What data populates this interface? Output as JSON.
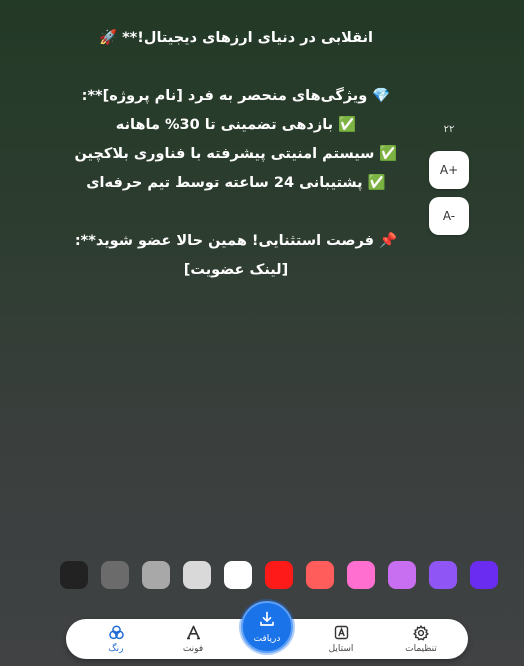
{
  "post": {
    "lines": [
      "انقلابی در دنیای ارزهای دیجیتال!** 🚀",
      "",
      "💎 ویژگی‌های منحصر به فرد [نام پروژه]**:",
      "✅ بازدهی تضمینی تا 30% ماهانه",
      "✅ سیستم امنیتی پیشرفته با فناوری بلاکچین",
      "✅ پشتیبانی 24 ساعته توسط تیم حرفه‌ای",
      "",
      "📌 فرصت استثنایی! همین حالا عضو شوید**:",
      "[لینک عضویت]"
    ]
  },
  "font_size": {
    "value": "۲۲",
    "increase_label": "A+",
    "decrease_label": "A-"
  },
  "swatches": [
    "#222222",
    "#6b6b6b",
    "#a8a8a8",
    "#d9d9d9",
    "#ffffff",
    "#ff1a1a",
    "#ff5c5c",
    "#ff6fcf",
    "#c86ef0",
    "#8f56f5",
    "#6a2cf0"
  ],
  "nav": {
    "color_label": "رنگ",
    "font_label": "فونت",
    "receive_label": "دریافت",
    "style_label": "استایل",
    "settings_label": "تنظیمات",
    "active": "color"
  },
  "colors": {
    "accent": "#1a73e8",
    "active_tab": "#1e6bd8"
  }
}
